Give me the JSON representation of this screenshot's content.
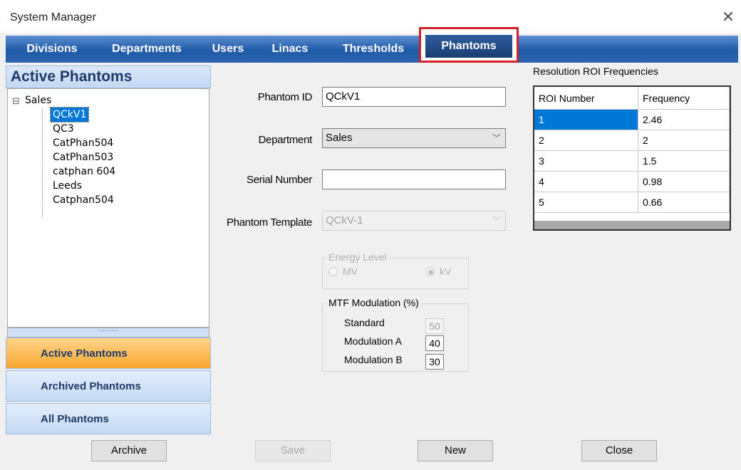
{
  "window": {
    "title": "System Manager",
    "close_glyph": "✕"
  },
  "tabs": [
    "Divisions",
    "Departments",
    "Users",
    "Linacs",
    "Thresholds",
    "Phantoms"
  ],
  "selected_tab": "Phantoms",
  "left_panel": {
    "header": "Active Phantoms",
    "tree": {
      "root": "Sales",
      "expander": "⊟",
      "children": [
        "QCkV1",
        "QC3",
        "CatPhan504",
        "CatPhan503",
        "catphan 604",
        "Leeds",
        "Catphan504"
      ],
      "selected": "QCkV1"
    },
    "splitter_glyph": "·········",
    "nav": [
      "Active Phantoms",
      "Archived Phantoms",
      "All Phantoms"
    ],
    "nav_selected": "Active Phantoms"
  },
  "form": {
    "phantom_id_label": "Phantom ID",
    "phantom_id_value": "QCkV1",
    "department_label": "Department",
    "department_value": "Sales",
    "serial_label": "Serial Number",
    "serial_value": "",
    "template_label": "Phantom Template",
    "template_value": "QCkV-1",
    "dropdown_glyph": "﹀",
    "energy": {
      "title": "Energy Level",
      "mv": "MV",
      "kv": "kV",
      "selected": "kV",
      "enabled": false
    },
    "mtf": {
      "title": "MTF Modulation (%)",
      "rows": [
        {
          "label": "Standard",
          "value": "50",
          "enabled": false
        },
        {
          "label": "Modulation A",
          "value": "40",
          "enabled": true
        },
        {
          "label": "Modulation B",
          "value": "30",
          "enabled": true
        }
      ]
    }
  },
  "roi_grid": {
    "title": "Resolution ROI Frequencies",
    "headers": [
      "ROI Number",
      "Frequency"
    ],
    "rows": [
      [
        "1",
        "2.46"
      ],
      [
        "2",
        "2"
      ],
      [
        "3",
        "1.5"
      ],
      [
        "4",
        "0.98"
      ],
      [
        "5",
        "0.66"
      ]
    ],
    "selected_row": 0
  },
  "buttons": {
    "archive": "Archive",
    "save": "Save",
    "new": "New",
    "close": "Close",
    "save_enabled": false
  },
  "colors": {
    "tab_blue": "#1f5aa8",
    "highlight_red": "#d0202a",
    "selection_blue": "#0078d7",
    "active_nav_orange": "#f7a630"
  }
}
